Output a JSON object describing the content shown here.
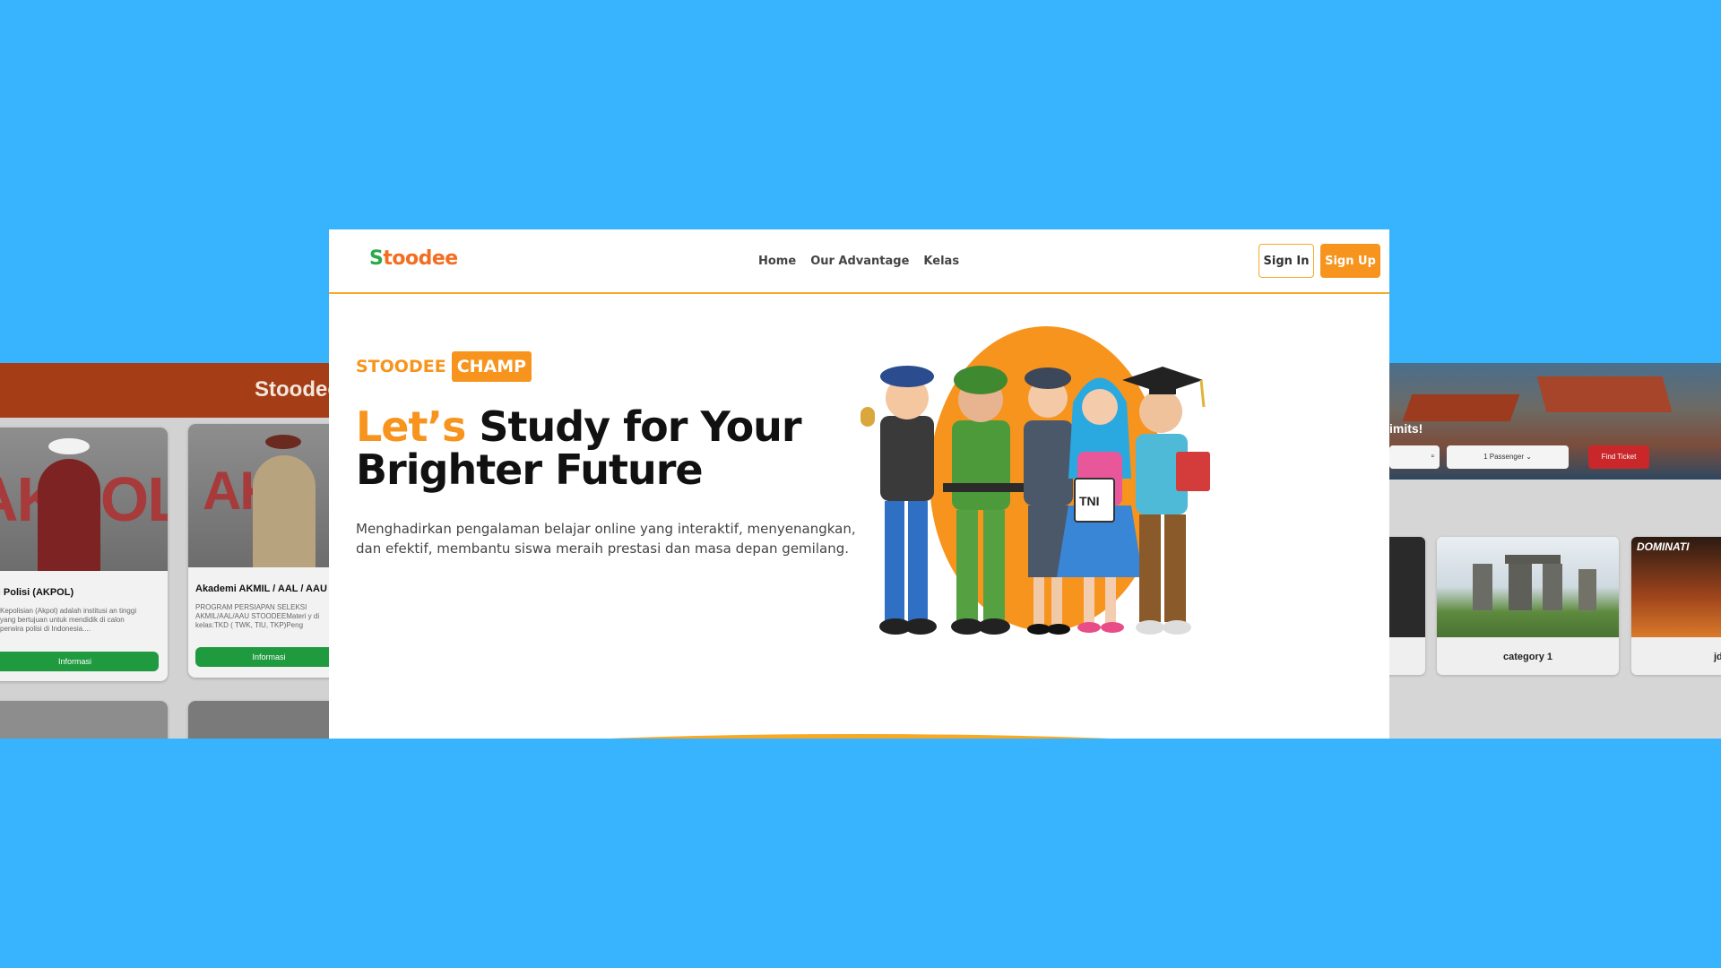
{
  "main": {
    "logo": {
      "s": "S",
      "rest": "toodee"
    },
    "nav": {
      "home": "Home",
      "advantage": "Our Advantage",
      "kelas": "Kelas"
    },
    "buttons": {
      "sign_in": "Sign In",
      "sign_up": "Sign Up"
    },
    "badge": {
      "plain": "STOODEE",
      "box": "CHAMP"
    },
    "headline": {
      "accent": "Let’s",
      "rest1": " Study for Your",
      "rest2": "Brighter Future"
    },
    "subtitle": "Menghadirkan pengalaman belajar online yang interaktif, menyenangkan, dan efektif, membantu siswa meraih prestasi dan masa depan gemilang.",
    "hero_labels": {
      "tni": "TNI",
      "tni_small": "TNI"
    }
  },
  "left_preview": {
    "logo": "Stoodee",
    "cards": [
      {
        "image_text": "AKPOL",
        "title": "mi Polisi (AKPOL)",
        "desc": "Kepolisian (Akpol) adalah institusi an tinggi yang bertujuan untuk mendidik di calon perwira polisi di Indonesia....",
        "button": "Informasi"
      },
      {
        "image_text": "AKA",
        "title": "Akademi AKMIL / AAL / AAU",
        "desc": "PROGRAM PERSIAPAN SELEKSI AKMIL/AAL/AAU STOODEEMateri y di kelas:TKD ( TWK, TIU, TKP)Peng",
        "button": "Informasi"
      }
    ]
  },
  "right_preview": {
    "hero_text": "imits!",
    "passenger": "1 Passenger",
    "find_ticket": "Find Ticket",
    "cards": [
      {
        "label": "category 1"
      },
      {
        "label": "jd"
      }
    ],
    "poster_text": "DOMINATI"
  },
  "colors": {
    "accent": "#f7941d",
    "background": "#38b4ff",
    "green": "#2aa84a"
  }
}
